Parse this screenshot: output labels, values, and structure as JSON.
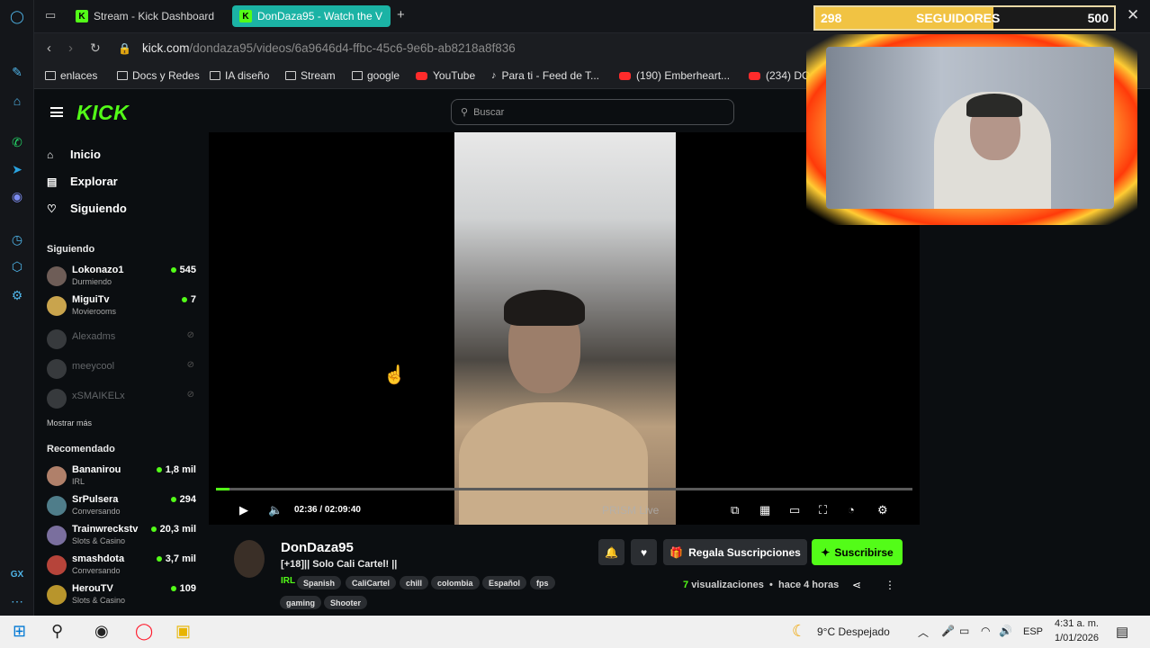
{
  "browser": {
    "tabs": [
      {
        "label": "Stream - Kick Dashboard",
        "active": false
      },
      {
        "label": "DonDaza95 - Watch the V",
        "active": true
      }
    ],
    "url_domain": "kick.com",
    "url_path": "/dondaza95/videos/6a9646d4-ffbc-45c6-9e6b-ab8218a8f836",
    "bookmarks": [
      {
        "label": "enlaces",
        "icon": "folder-icon"
      },
      {
        "label": "Docs y Redes",
        "icon": "folder-icon"
      },
      {
        "label": "IA diseño",
        "icon": "folder-icon"
      },
      {
        "label": "Stream",
        "icon": "folder-icon"
      },
      {
        "label": "google",
        "icon": "folder-icon"
      },
      {
        "label": "YouTube",
        "icon": "youtube-icon"
      },
      {
        "label": "Para ti - Feed de T...",
        "icon": "tiktok-icon"
      },
      {
        "label": "(190) Emberheart...",
        "icon": "youtube-icon"
      },
      {
        "label": "(234) DOO",
        "icon": "youtube-icon"
      }
    ]
  },
  "sidebar": {
    "nav": [
      {
        "label": "Inicio",
        "icon": "home-icon"
      },
      {
        "label": "Explorar",
        "icon": "browse-icon"
      },
      {
        "label": "Siguiendo",
        "icon": "heart-icon"
      }
    ],
    "following_title": "Siguiendo",
    "following": [
      {
        "name": "Lokonazo1",
        "sub": "Durmiendo",
        "count": "545",
        "live": true
      },
      {
        "name": "MiguiTv",
        "sub": "Movierooms",
        "count": "7",
        "live": true
      },
      {
        "name": "Alexadms",
        "sub": "",
        "count": "",
        "live": false
      },
      {
        "name": "meeycool",
        "sub": "",
        "count": "",
        "live": false
      },
      {
        "name": "xSMAIKELx",
        "sub": "",
        "count": "",
        "live": false
      }
    ],
    "show_more": "Mostrar más",
    "recommended_title": "Recomendado",
    "recommended": [
      {
        "name": "Bananirou",
        "sub": "IRL",
        "count": "1,8 mil"
      },
      {
        "name": "SrPulsera",
        "sub": "Conversando",
        "count": "294"
      },
      {
        "name": "Trainwreckstv",
        "sub": "Slots & Casino",
        "count": "20,3 mil"
      },
      {
        "name": "smashdota",
        "sub": "Conversando",
        "count": "3,7 mil"
      },
      {
        "name": "HerouTV",
        "sub": "Slots & Casino",
        "count": "109"
      }
    ]
  },
  "logo": "KICK",
  "search": {
    "placeholder": "Buscar"
  },
  "player": {
    "time": "02:36 / 02:09:40",
    "watermark": "PRISM Live",
    "progress": 0.02
  },
  "channel": {
    "name": "DonDaza95",
    "title": "[+18]|| Solo Cali Cartel! ||",
    "category": "IRL",
    "tags": [
      "Spanish",
      "CaliCartel",
      "chill",
      "colombia",
      "Español",
      "fps",
      "gaming",
      "Shooter"
    ],
    "gift_label": "Regala Suscripciones",
    "subscribe_label": "Suscribirse",
    "views_count": "7",
    "views_label": "visualizaciones",
    "ago": "hace 4 horas"
  },
  "overlay": {
    "left": "298",
    "middle": "SEGUIDORES",
    "right": "500",
    "progress": 0.596
  },
  "taskbar": {
    "weather": "9°C Despejado",
    "lang": "ESP",
    "time": "4:31 a. m.",
    "date": "1/01/2026"
  }
}
